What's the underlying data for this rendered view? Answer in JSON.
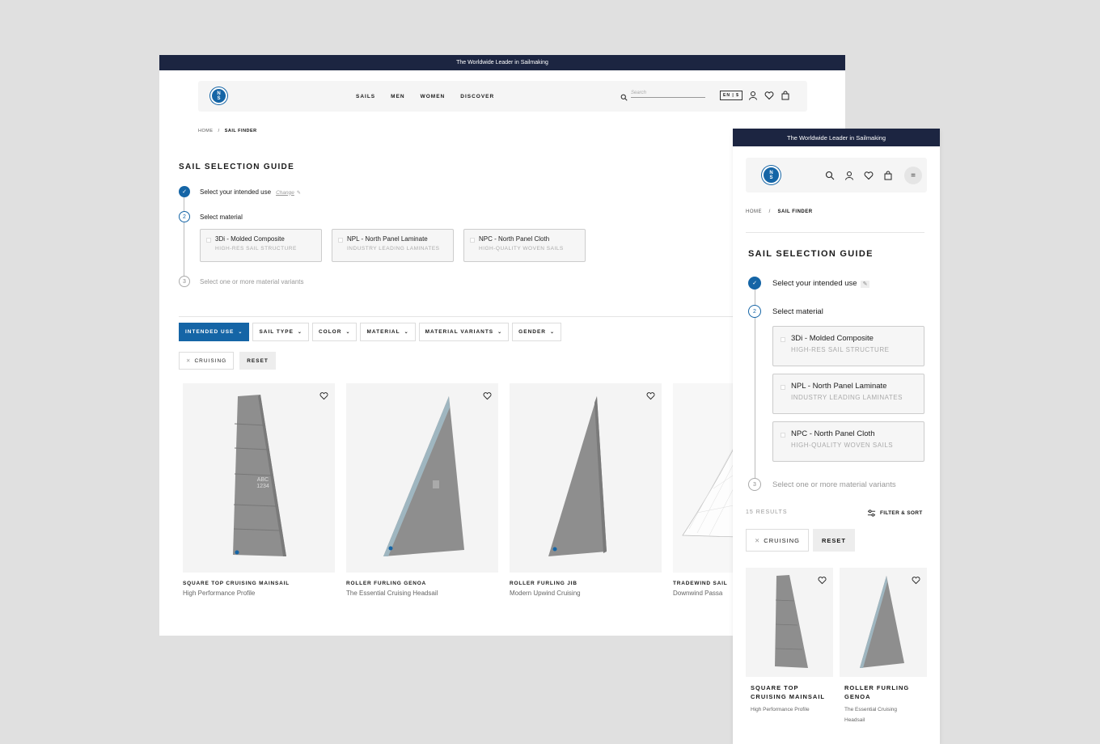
{
  "desktop": {
    "banner": "The Worldwide Leader in Sailmaking",
    "logo": {
      "top": "N",
      "bottom": "S"
    },
    "menu": [
      "SAILS",
      "MEN",
      "WOMEN",
      "DISCOVER"
    ],
    "search_placeholder": "Search",
    "lang": "EN | $",
    "breadcrumb": {
      "home": "HOME",
      "sep": "/",
      "current": "SAIL FINDER"
    },
    "title": "SAIL SELECTION GUIDE",
    "steps": {
      "step1": {
        "label": "Select your intended use",
        "action": "Change",
        "num": "✓"
      },
      "step2": {
        "label": "Select material",
        "num": "2"
      },
      "step3": {
        "label": "Select one or more material variants",
        "num": "3"
      }
    },
    "materials": [
      {
        "name": "3Di - Molded Composite",
        "sub": "HIGH-RES SAIL STRUCTURE"
      },
      {
        "name": "NPL - North Panel Laminate",
        "sub": "INDUSTRY LEADING LAMINATES"
      },
      {
        "name": "NPC - North Panel Cloth",
        "sub": "HIGH-QUALITY WOVEN SAILS"
      }
    ],
    "filters": [
      "INTENDED USE",
      "SAIL TYPE",
      "COLOR",
      "MATERIAL",
      "MATERIAL VARIANTS",
      "GENDER"
    ],
    "chips": {
      "active": "CRUISING",
      "reset": "RESET"
    },
    "products": [
      {
        "name": "SQUARE TOP CRUISING MAINSAIL",
        "sub": "High Performance Profile",
        "marking": "ABC 1234"
      },
      {
        "name": "ROLLER FURLING GENOA",
        "sub": "The Essential Cruising Headsail"
      },
      {
        "name": "ROLLER FURLING JIB",
        "sub": "Modern Upwind Cruising"
      },
      {
        "name": "TRADEWIND SAIL",
        "sub": "Downwind Passa"
      }
    ]
  },
  "mobile": {
    "banner": "The Worldwide Leader in Sailmaking",
    "logo": {
      "top": "N",
      "bottom": "S"
    },
    "breadcrumb": {
      "home": "HOME",
      "sep": "/",
      "current": "SAIL FINDER"
    },
    "title": "SAIL SELECTION GUIDE",
    "steps": {
      "step1": {
        "label": "Select your intended use",
        "num": "✓"
      },
      "step2": {
        "label": "Select material",
        "num": "2"
      },
      "step3": {
        "label": "Select one or more material variants",
        "num": "3"
      }
    },
    "materials": [
      {
        "name": "3Di - Molded Composite",
        "sub": "HIGH-RES SAIL STRUCTURE"
      },
      {
        "name": "NPL - North Panel Laminate",
        "sub": "INDUSTRY LEADING LAMINATES"
      },
      {
        "name": "NPC - North Panel Cloth",
        "sub": "HIGH-QUALITY WOVEN SAILS"
      }
    ],
    "results": "15 RESULTS",
    "filter_sort": "FILTER & SORT",
    "chips": {
      "active": "CRUISING",
      "reset": "RESET"
    },
    "products": [
      {
        "name": "SQUARE TOP CRUISING MAINSAIL",
        "sub": "High Performance Profile"
      },
      {
        "name": "ROLLER FURLING GENOA",
        "sub": "The Essential Cruising Headsail"
      }
    ]
  },
  "colors": {
    "navy": "#1c2541",
    "accent": "#1565a6",
    "sail": "#8a8a8a"
  }
}
